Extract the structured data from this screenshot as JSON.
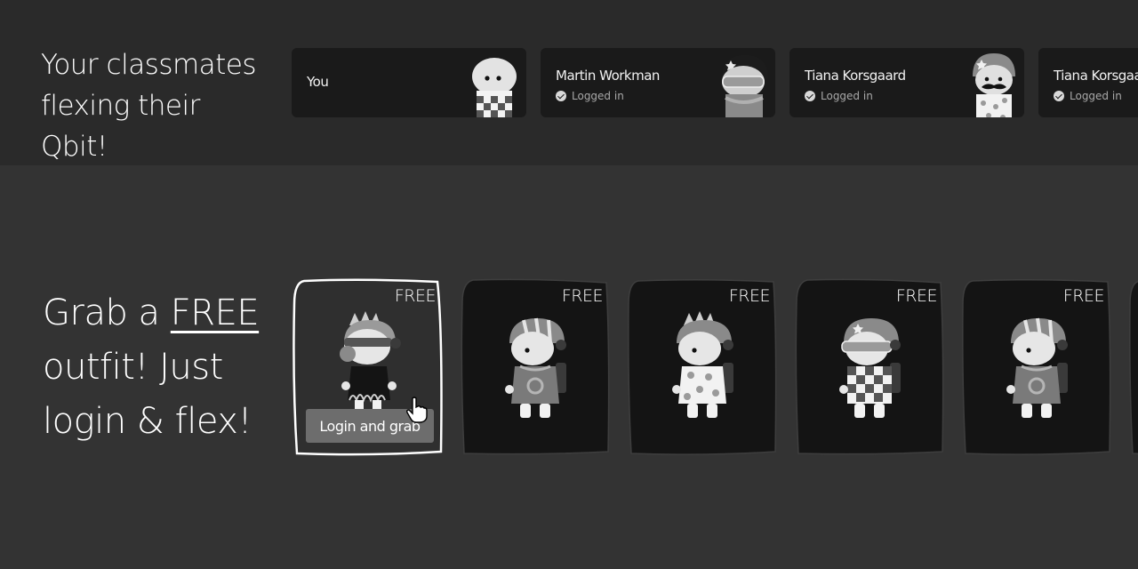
{
  "classmates_section": {
    "heading_line1": "Your classmates",
    "heading_line2": "flexing their Qbit!",
    "cards": [
      {
        "name": "You",
        "status": "",
        "avatar": "plain-avatar"
      },
      {
        "name": "Martin Workman",
        "status": "Logged in",
        "avatar": "goggles-star-helmet-avatar"
      },
      {
        "name": "Tiana Korsgaard",
        "status": "Logged in",
        "avatar": "star-helmet-mustache-avatar"
      },
      {
        "name": "Tiana Korsgaard",
        "status": "Logged in",
        "avatar": "partial-avatar"
      }
    ]
  },
  "offers_section": {
    "heading_pre": "Grab a ",
    "heading_free": "FREE",
    "heading_line2": "outfit! Just",
    "heading_line3": "login & flex!",
    "offers": [
      {
        "price": "FREE",
        "button_label": "Login and grab",
        "outfit": "spiked-helmet-flame-outfit",
        "highlighted": true
      },
      {
        "price": "FREE",
        "outfit": "striped-helmet-robe-outfit"
      },
      {
        "price": "FREE",
        "outfit": "spiked-helmet-flower-shirt-outfit"
      },
      {
        "price": "FREE",
        "outfit": "star-helmet-checkered-outfit"
      },
      {
        "price": "FREE",
        "outfit": "striped-helmet-robe-outfit"
      }
    ]
  },
  "colors": {
    "page_background": "#333333",
    "top_band": "#2a2a2a",
    "card": "#1a1a1a",
    "button": "#6d6d6d"
  }
}
